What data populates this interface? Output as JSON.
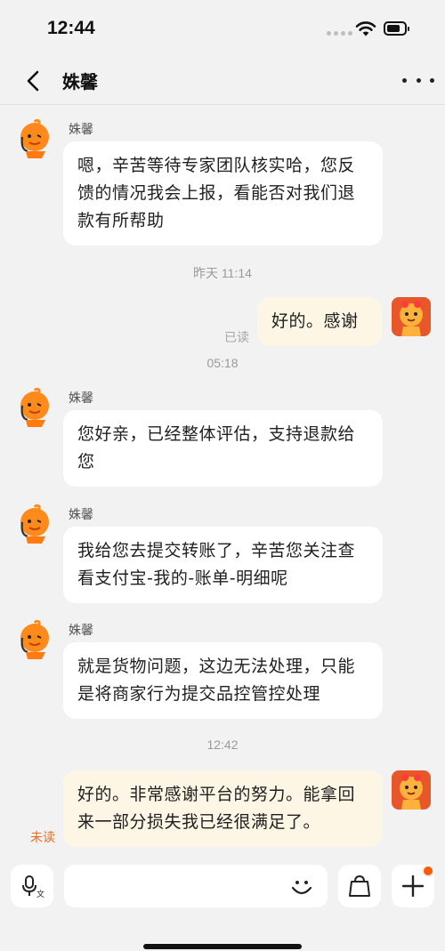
{
  "status_bar": {
    "time": "12:44"
  },
  "nav": {
    "title": "姝馨"
  },
  "messages": [
    {
      "sender": "姝馨",
      "text": "嗯，辛苦等待专家团队核实哈，您反馈的情况我会上报，看能否对我们退款有所帮助"
    },
    {
      "timestamp": "昨天 11:14"
    },
    {
      "text": "好的。感谢",
      "status": "已读"
    },
    {
      "timestamp": "05:18"
    },
    {
      "sender": "姝馨",
      "text": "您好亲，已经整体评估，支持退款给您"
    },
    {
      "sender": "姝馨",
      "text": "我给您去提交转账了，辛苦您关注查看支付宝-我的-账单-明细呢"
    },
    {
      "sender": "姝馨",
      "text": "就是货物问题，这边无法处理，只能是将商家行为提交品控管控处理"
    },
    {
      "timestamp": "12:42"
    },
    {
      "text": "好的。非常感谢平台的努力。能拿回来一部分损失我已经很满足了。",
      "status": "未读"
    }
  ],
  "input": {
    "placeholder": "",
    "value": ""
  },
  "colors": {
    "accent": "#ff5a00",
    "my_bubble": "#fef6e5",
    "unread": "#ef6a1b"
  },
  "icons": [
    "back-arrow-icon",
    "more-icon",
    "voice-icon",
    "emoji-icon",
    "shopping-bag-icon",
    "plus-icon"
  ]
}
